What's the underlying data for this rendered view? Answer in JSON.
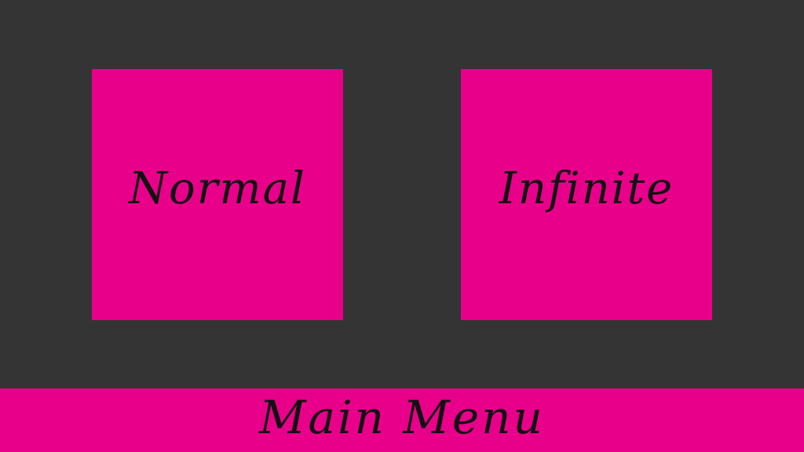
{
  "modes": {
    "normal_label": "Normal",
    "infinite_label": "Infinite"
  },
  "footer": {
    "main_menu_label": "Main Menu"
  },
  "colors": {
    "background": "#343434",
    "accent": "#E8008A",
    "text": "#111111"
  }
}
